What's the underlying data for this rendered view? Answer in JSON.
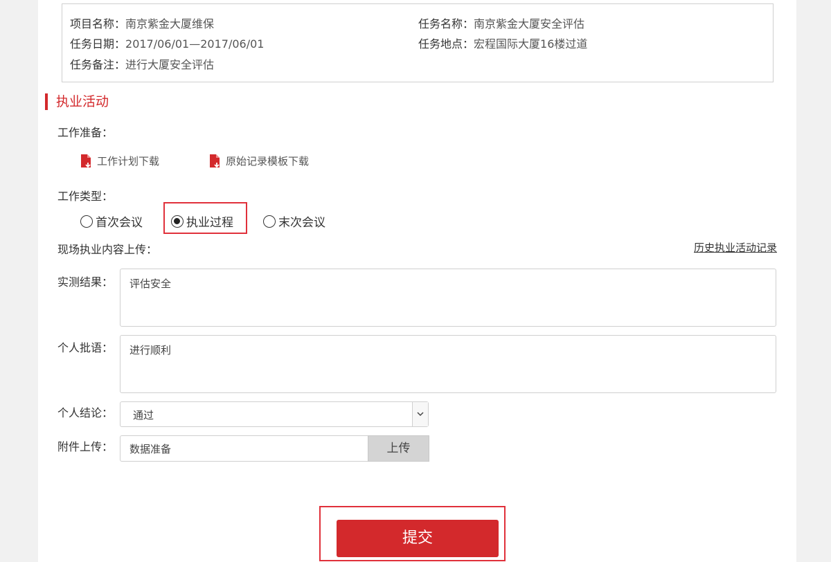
{
  "info": {
    "project_name": {
      "key": "项目名称：",
      "value": "南京紫金大厦维保"
    },
    "task_name": {
      "key": "任务名称：",
      "value": "南京紫金大厦安全评估"
    },
    "task_date": {
      "key": "任务日期：",
      "value": "2017/06/01—2017/06/01"
    },
    "task_location": {
      "key": "任务地点：",
      "value": "宏程国际大厦16楼过道"
    },
    "task_note": {
      "key": "任务备注：",
      "value": "进行大厦安全评估"
    }
  },
  "section_title": "执业活动",
  "prep": {
    "label": "工作准备：",
    "downloads": [
      {
        "label": "工作计划下载",
        "icon": "file-download-icon"
      },
      {
        "label": "原始记录模板下载",
        "icon": "file-download-icon"
      }
    ]
  },
  "work_type": {
    "label": "工作类型：",
    "options": [
      {
        "label": "首次会议",
        "checked": false
      },
      {
        "label": "执业过程",
        "checked": true
      },
      {
        "label": "末次会议",
        "checked": false
      }
    ]
  },
  "upload_section": {
    "label": "现场执业内容上传：",
    "history_link": "历史执业活动记录"
  },
  "form": {
    "measure_label": "实测结果：",
    "measure_value": "评估安全",
    "comment_label": "个人批语：",
    "comment_value": "进行顺利",
    "conclusion_label": "个人结论：",
    "conclusion_value": "通过",
    "attachment_label": "附件上传：",
    "attachment_value": "数据准备",
    "upload_button": "上传"
  },
  "submit_label": "提交",
  "colors": {
    "accent": "#d3292c",
    "highlight": "#e0303a",
    "border": "#cfcfcf"
  }
}
